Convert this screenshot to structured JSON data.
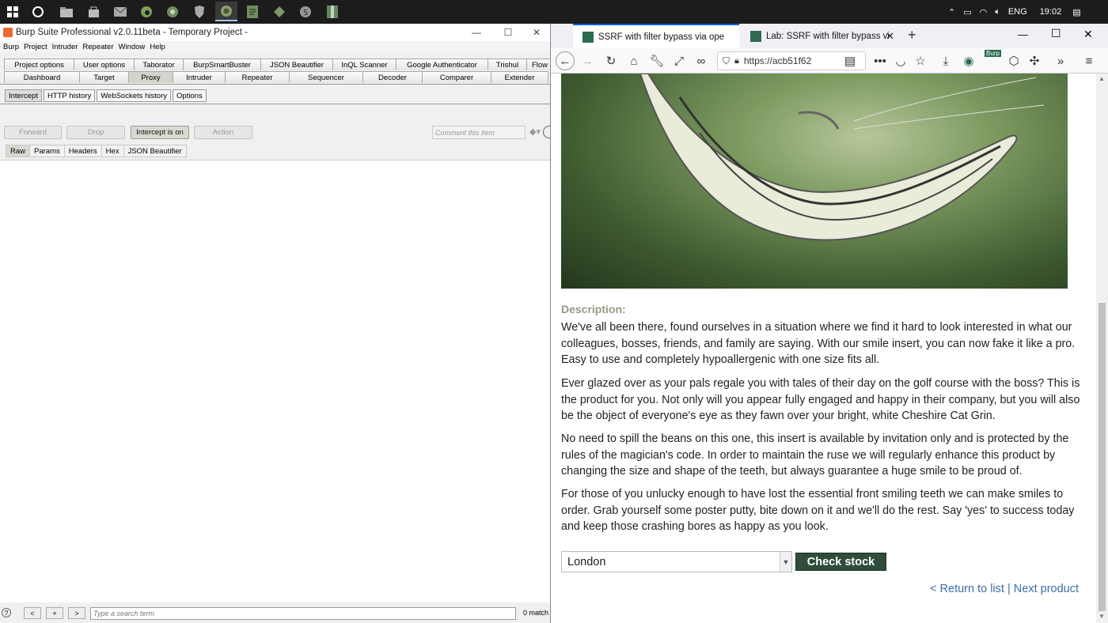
{
  "taskbar": {
    "icons": [
      "windows-start",
      "cortana",
      "file-explorer",
      "store",
      "mail",
      "edge",
      "chrome",
      "brave",
      "firefox",
      "notepad",
      "burp",
      "skype",
      "winrar"
    ],
    "lang": "ENG",
    "time": "19:02"
  },
  "burp": {
    "title": "Burp Suite Professional v2.0.11beta - Temporary Project -",
    "menu": [
      "Burp",
      "Project",
      "Intruder",
      "Repeater",
      "Window",
      "Help"
    ],
    "top_tabs_row1": [
      "Project options",
      "User options",
      "Taborator",
      "BurpSmartBuster",
      "JSON Beautifier",
      "InQL Scanner",
      "Google Authenticator",
      "Trishul",
      "Flow"
    ],
    "top_tabs_row2": [
      "Dashboard",
      "Target",
      "Proxy",
      "Intruder",
      "Repeater",
      "Sequencer",
      "Decoder",
      "Comparer",
      "Extender"
    ],
    "selected_tab": "Proxy",
    "proxy_tabs": [
      "Intercept",
      "HTTP history",
      "WebSockets history",
      "Options"
    ],
    "buttons": {
      "forward": "Forward",
      "drop": "Drop",
      "intercept": "Intercept is on",
      "action": "Action"
    },
    "comment_placeholder": "Comment this item",
    "view_tabs": [
      "Raw",
      "Params",
      "Headers",
      "Hex",
      "JSON Beautifier"
    ],
    "search": {
      "help": "?",
      "prev": "<",
      "add": "+",
      "next": ">",
      "placeholder": "Type a search term",
      "matches": "0 match"
    }
  },
  "firefox": {
    "tabs": [
      {
        "title": "SSRF with filter bypass via ope"
      },
      {
        "title": "Lab: SSRF with filter bypass via"
      }
    ],
    "url": "https://acb51f62",
    "extension_badge": "Burp"
  },
  "page": {
    "description_title": "Description:",
    "paragraphs": [
      "We've all been there, found ourselves in a situation where we find it hard to look interested in what our colleagues, bosses, friends, and family are saying. With our smile insert, you can now fake it like a pro. Easy to use and completely hypoallergenic with one size fits all.",
      "Ever glazed over as your pals regale you with tales of their day on the golf course with the boss? This is the product for you. Not only will you appear fully engaged and happy in their company, but you will also be the object of everyone's eye as they fawn over your bright, white Cheshire Cat Grin.",
      "No need to spill the beans on this one, this insert is available by invitation only and is protected by the rules of the magician's code. In order to maintain the ruse we will regularly enhance this product by changing the size and shape of the teeth, but always guarantee a huge smile to be proud of.",
      "For those of you unlucky enough to have lost the essential front smiling teeth we can make smiles to order. Grab yourself some poster putty, bite down on it and we'll do the rest. Say 'yes' to success today and keep those crashing bores as happy as you look."
    ],
    "store_select": "London",
    "check_stock": "Check stock",
    "return_link": "< Return to list",
    "separator": "|",
    "next_link": "Next product"
  }
}
